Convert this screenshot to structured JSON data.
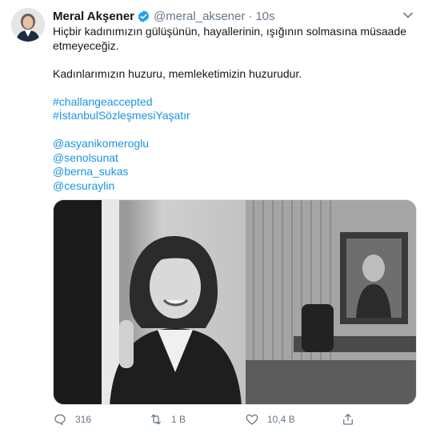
{
  "tweet": {
    "display_name": "Meral Akşener",
    "handle": "@meral_aksener",
    "separator": "·",
    "time": "10s",
    "text": {
      "line1": "Hiçbir kadınımızın gülüşünün, hayallerinin, ışığının solmasına müsaade etmeyeceğiz.",
      "line2": "Kadınlarımızın huzuru, memleketimizin huzurudur.",
      "hashtags": [
        "#challangeaccepted",
        "#İstanbulSözleşmesiYaşatır"
      ],
      "mentions": [
        "@asyanikomeroglu",
        "@senolsunat",
        "@berna_sukas",
        "@cesuraylin"
      ]
    },
    "media_description": "black-and-white photo",
    "actions": {
      "reply_count": "316",
      "retweet_count": "1 B",
      "like_count": "10,4 B"
    }
  },
  "colors": {
    "link": "#1b95e0",
    "verified": "#1da1f2",
    "muted": "#657786"
  },
  "icons": {
    "verified": "verified-badge-icon",
    "caret": "chevron-down-icon",
    "reply": "reply-icon",
    "retweet": "retweet-icon",
    "like": "heart-icon",
    "share": "share-icon"
  }
}
